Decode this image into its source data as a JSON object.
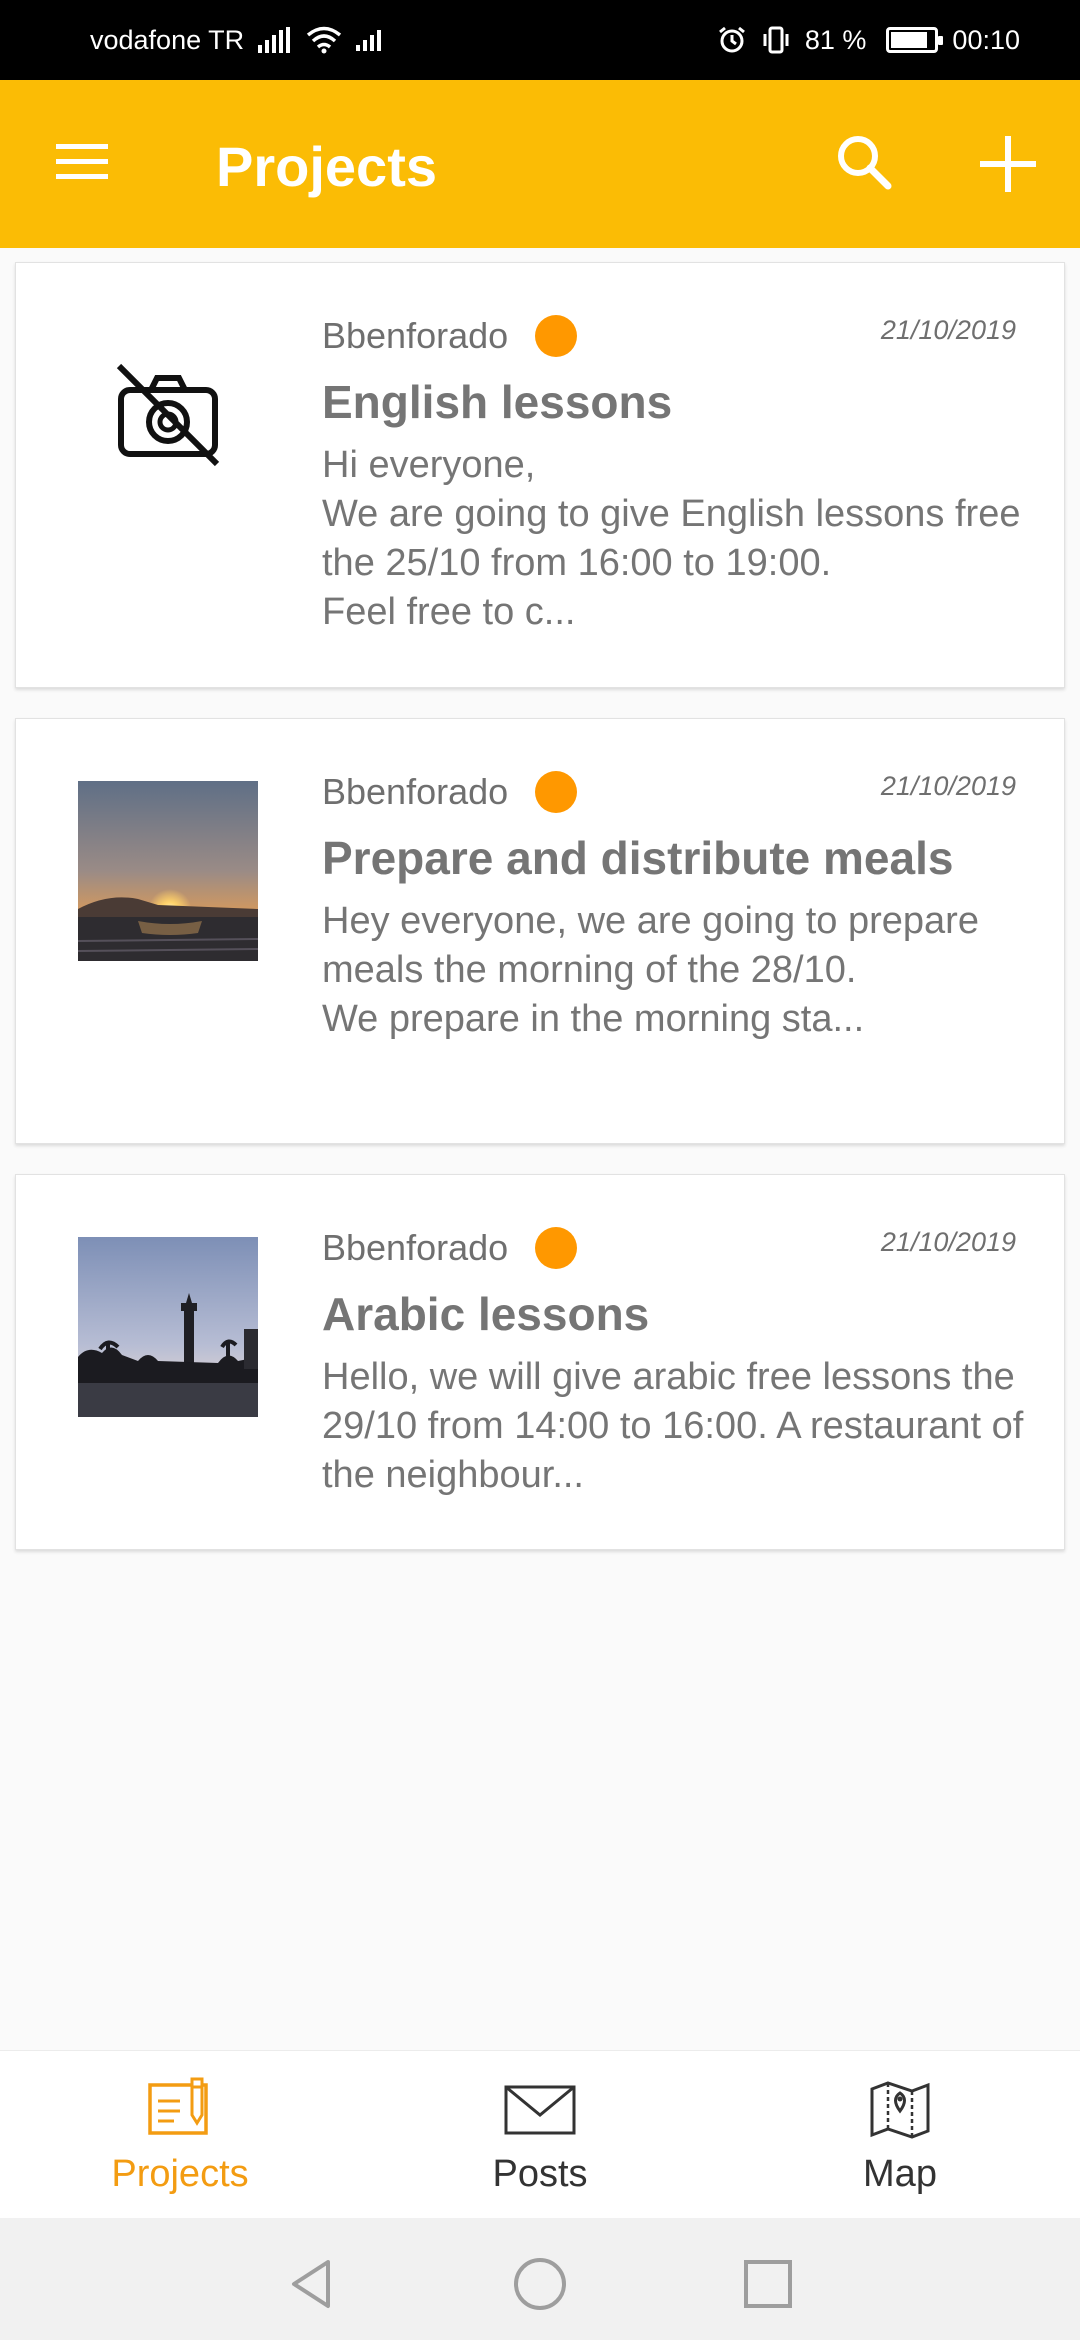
{
  "status_bar": {
    "carrier": "vodafone TR",
    "battery_percent_text": "81 %",
    "battery_level": 0.81,
    "time": "00:10",
    "icons": [
      "signal-icon",
      "wifi-icon",
      "data-icon",
      "alarm-icon",
      "vibrate-icon",
      "battery-icon"
    ]
  },
  "app_bar": {
    "title": "Projects",
    "background": "#fbbc05",
    "icons": [
      "menu-icon",
      "search-icon",
      "add-icon"
    ]
  },
  "projects": [
    {
      "author": "Bbenforado",
      "date": "21/10/2019",
      "title": "English lessons",
      "excerpt": "Hi everyone,\nWe are going to give English lessons free the 25/10 from 16:00 to 19:00.\nFeel free to c...",
      "thumbnail": "no-photo-icon",
      "status_color": "#ff9800"
    },
    {
      "author": "Bbenforado",
      "date": "21/10/2019",
      "title": "Prepare and distribute meals",
      "excerpt": "Hey everyone, we are going to prepare meals the morning of the 28/10.\nWe prepare in the morning sta...",
      "thumbnail": "sunset-photo",
      "status_color": "#ff9800"
    },
    {
      "author": "Bbenforado",
      "date": "21/10/2019",
      "title": "Arabic lessons",
      "excerpt": "Hello, we will give arabic free lessons the 29/10 from 14:00 to 16:00. A restaurant of the neighbour...",
      "thumbnail": "clock-tower-photo",
      "status_color": "#ff9800"
    }
  ],
  "bottom_nav": {
    "items": [
      {
        "label": "Projects",
        "icon": "projects-icon",
        "active": true
      },
      {
        "label": "Posts",
        "icon": "mail-icon",
        "active": false
      },
      {
        "label": "Map",
        "icon": "map-icon",
        "active": false
      }
    ],
    "active_color": "#f39c12"
  },
  "system_nav": {
    "icons": [
      "back-icon",
      "home-icon",
      "recents-icon"
    ]
  }
}
